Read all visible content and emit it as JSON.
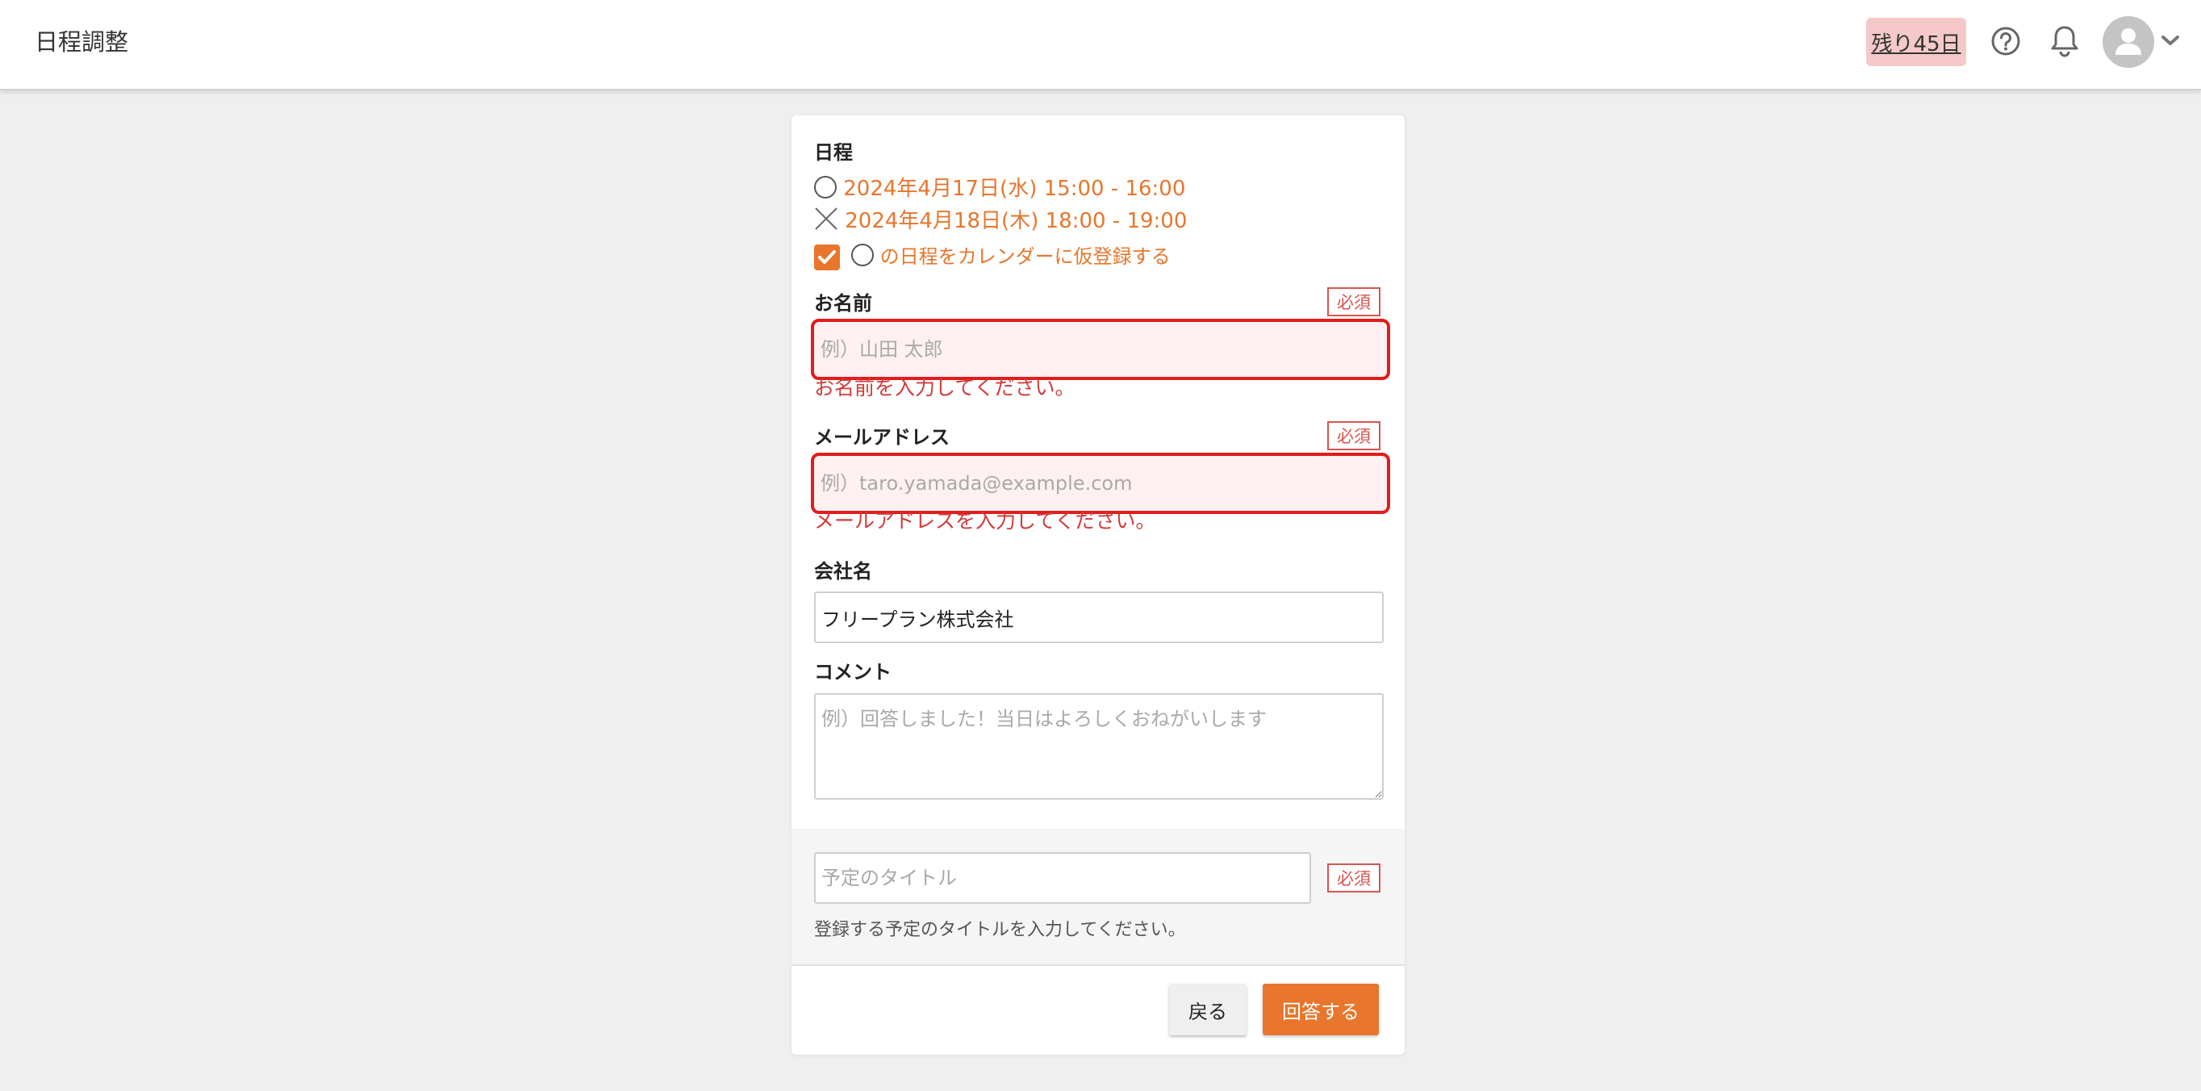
{
  "header": {
    "title": "日程調整",
    "trial_badge": "残り45日",
    "icons": [
      "help-icon",
      "bell-icon",
      "user-avatar-icon",
      "chevron-down-icon"
    ]
  },
  "form": {
    "schedule": {
      "label": "日程",
      "slots": [
        {
          "symbol": "circle",
          "text": "2024年4月17日(水) 15:00 - 16:00"
        },
        {
          "symbol": "cross",
          "text": "2024年4月18日(木) 18:00 - 19:00"
        }
      ],
      "calendar_option": {
        "checked": true,
        "text": "の日程をカレンダーに仮登録する"
      }
    },
    "required_label": "必須",
    "name": {
      "label": "お名前",
      "placeholder": "例）山田 太郎",
      "value": "",
      "error": "お名前を入力してください。"
    },
    "email": {
      "label": "メールアドレス",
      "placeholder": "例）taro.yamada@example.com",
      "value": "",
      "error": "メールアドレスを入力してください。"
    },
    "company": {
      "label": "会社名",
      "value": "フリープラン株式会社"
    },
    "comment": {
      "label": "コメント",
      "placeholder": "例）回答しました！当日はよろしくおねがいします",
      "value": ""
    },
    "event_title": {
      "placeholder": "予定のタイトル",
      "value": "",
      "hint": "登録する予定のタイトルを入力してください。"
    },
    "buttons": {
      "back": "戻る",
      "submit": "回答する"
    }
  },
  "colors": {
    "accent": "#e8762c",
    "error": "#e01d1d",
    "trial_badge_bg": "#f5c9c9",
    "page_bg": "#efefef"
  }
}
